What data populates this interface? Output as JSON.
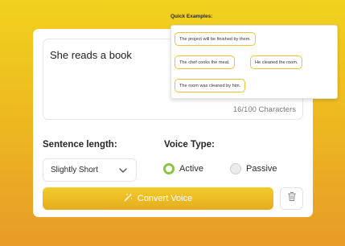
{
  "input": {
    "text": "She reads a book",
    "char_count": "16/100 Characters"
  },
  "sentence_length": {
    "label": "Sentence length:",
    "selected": "Slightly Short"
  },
  "voice_type": {
    "label": "Voice Type:",
    "options": [
      {
        "label": "Active",
        "checked": true
      },
      {
        "label": "Passive",
        "checked": false
      }
    ]
  },
  "actions": {
    "convert_label": "Convert Voice"
  },
  "quick_examples": {
    "title": "Quick Examples:",
    "items": [
      "The project will be finished by them.",
      "The chef cooks the meal.",
      "He cleaned the room.",
      "The room was cleaned by him."
    ]
  },
  "colors": {
    "accent": "#f0c235",
    "active_radio": "#8bc43f",
    "background_top": "#f1d21d",
    "background_bottom": "#e79b28"
  }
}
